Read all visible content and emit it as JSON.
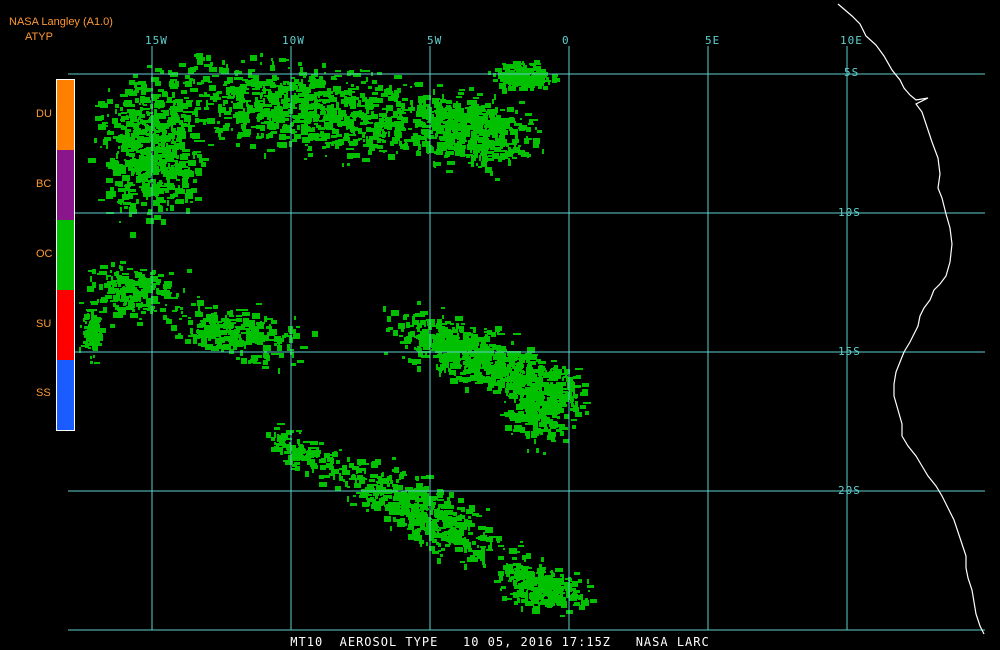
{
  "header": {
    "product": "NASA Langley (A1.0)",
    "parameter": "ATYP"
  },
  "legend": {
    "classes": [
      {
        "code": "DU",
        "color": "#ff8000"
      },
      {
        "code": "BC",
        "color": "#8b168b"
      },
      {
        "code": "OC",
        "color": "#00c000"
      },
      {
        "code": "SU",
        "color": "#ff0000"
      },
      {
        "code": "SS",
        "color": "#1a5cff"
      }
    ]
  },
  "grid": {
    "longitudes": [
      "15W",
      "10W",
      "5W",
      "0",
      "5E",
      "10E"
    ],
    "latitudes": [
      "5S",
      "10S",
      "15S",
      "20S"
    ],
    "color": "#5fd0d0"
  },
  "footer": {
    "caption": "MT10  AEROSOL TYPE   10 05, 2016 17:15Z   NASA LARC"
  },
  "colors": {
    "background": "#000000",
    "coastline": "#ffffff",
    "aerosol": "#00c000"
  }
}
